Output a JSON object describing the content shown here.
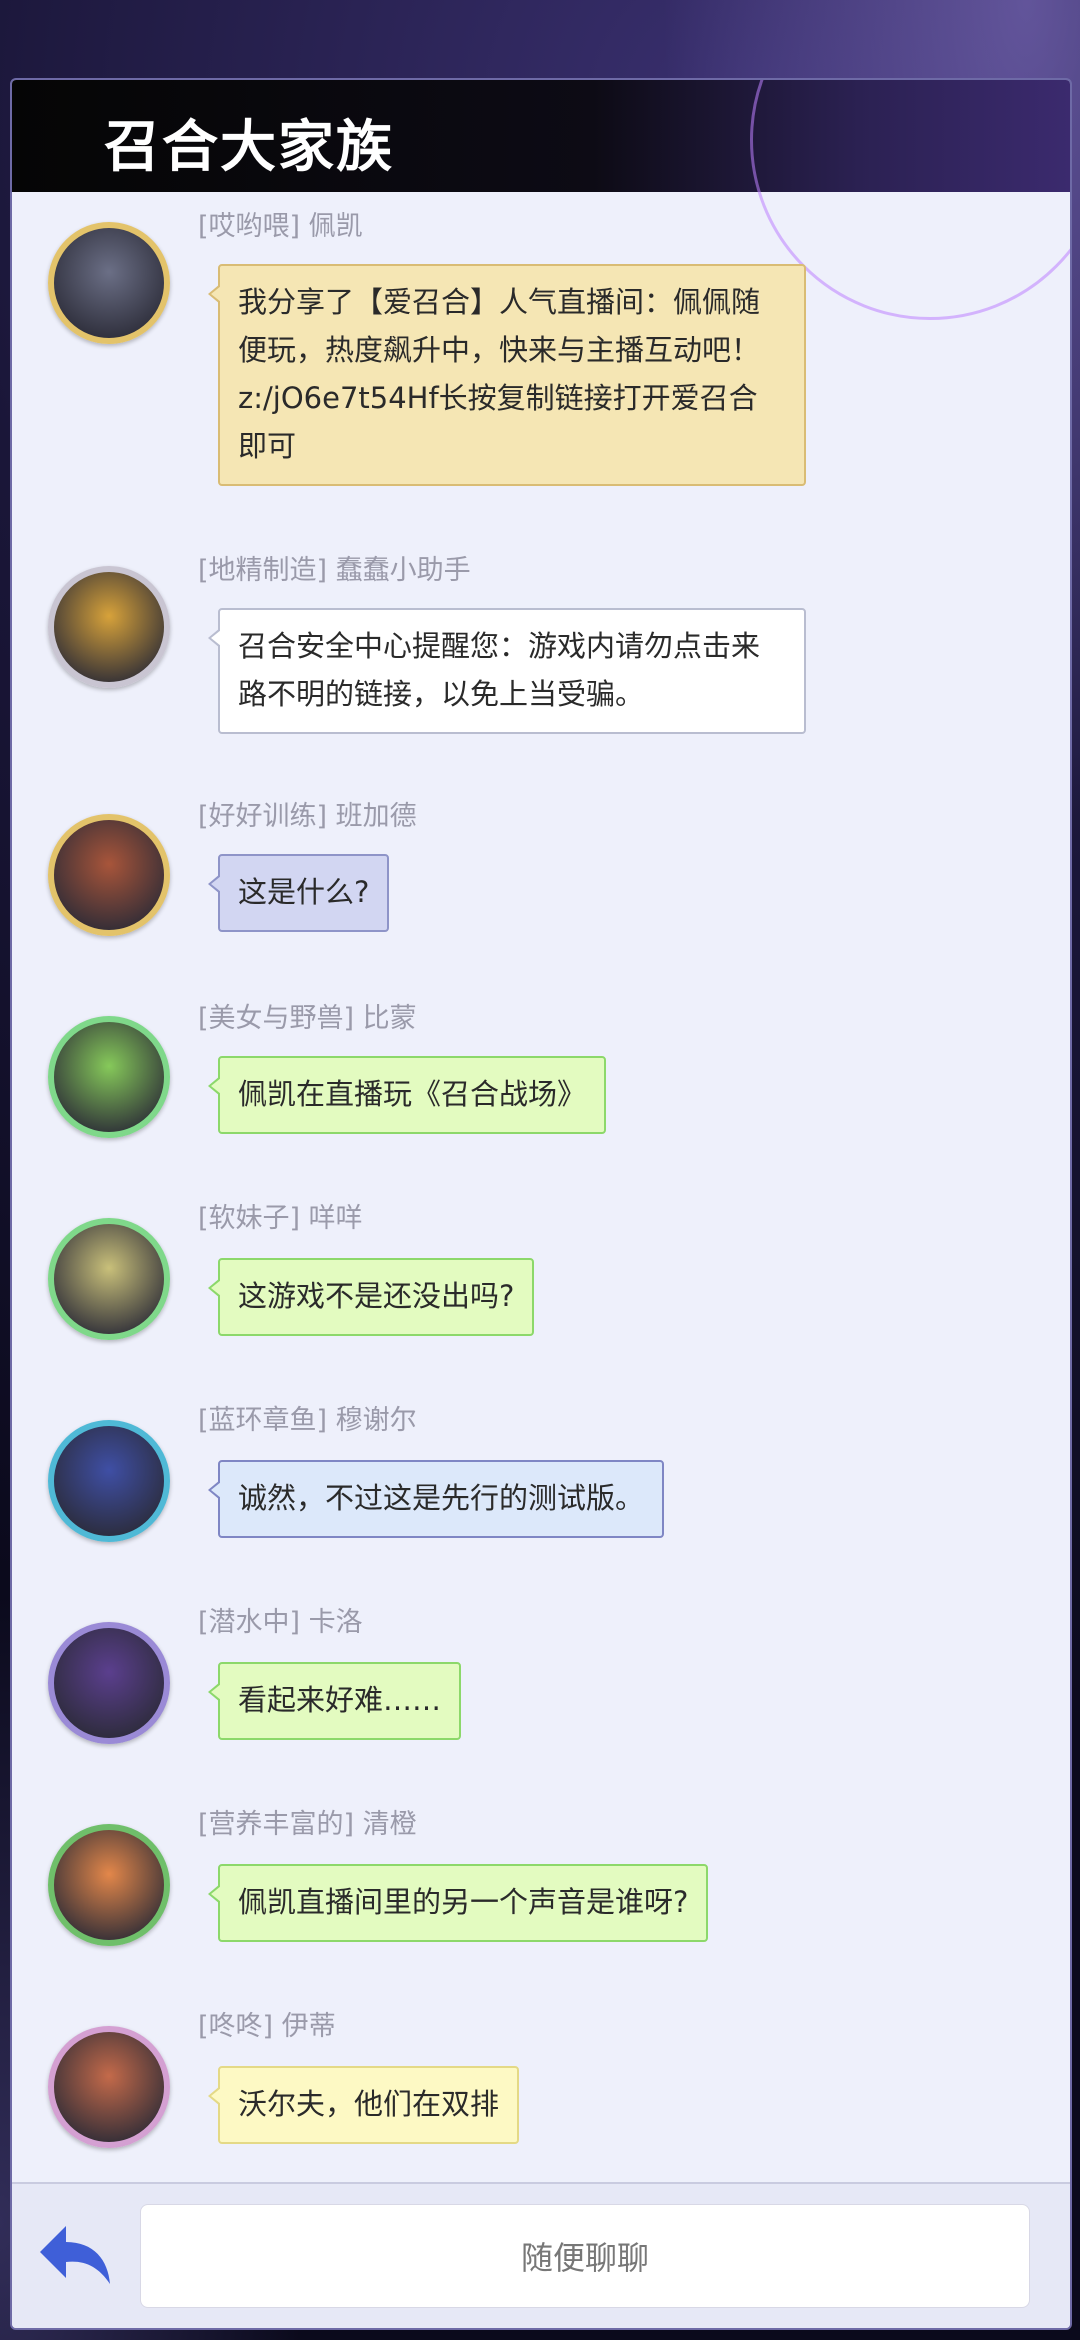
{
  "header": {
    "title": "召合大家族"
  },
  "messages": [
    {
      "tag": "[哎哟喂]",
      "name": "佩凯",
      "text": "我分享了【爱召合】人气直播间：佩佩随便玩，热度飙升中，快来与主播互动吧！z:/jO6e7t54Hf长按复制链接打开爱召合即可",
      "bubble_bg": "#f5e6b4",
      "bubble_border": "#d9bc74",
      "ring": "#e3c36a",
      "avatar_color": "#6b6f86"
    },
    {
      "tag": "[地精制造]",
      "name": "蠢蠢小助手",
      "text": "召合安全中心提醒您：游戏内请勿点击来路不明的链接，以免上当受骗。",
      "bubble_bg": "#ffffff",
      "bubble_border": "#b9bdd0",
      "ring": "#c9c5d2",
      "avatar_color": "#d7a23a"
    },
    {
      "tag": "[好好训练]",
      "name": "班加德",
      "text": "这是什么?",
      "bubble_bg": "#d2d6f2",
      "bubble_border": "#8e94c8",
      "ring": "#e3c36a",
      "avatar_color": "#a8553a"
    },
    {
      "tag": "[美女与野兽]",
      "name": "比蒙",
      "text": "佩凯在直播玩《召合战场》",
      "bubble_bg": "#e3fbc0",
      "bubble_border": "#8cd86a",
      "ring": "#7fd88a",
      "avatar_color": "#86c95a"
    },
    {
      "tag": "[软妹子]",
      "name": "咩咩",
      "text": "这游戏不是还没出吗?",
      "bubble_bg": "#e3fbc0",
      "bubble_border": "#8cd86a",
      "ring": "#7fd88a",
      "avatar_color": "#c9c07a"
    },
    {
      "tag": "[蓝环章鱼]",
      "name": "穆谢尔",
      "text": "诚然，不过这是先行的测试版。",
      "bubble_bg": "#dce8fa",
      "bubble_border": "#7f86c4",
      "ring": "#4fb9d6",
      "avatar_color": "#3f4fa5"
    },
    {
      "tag": "[潜水中]",
      "name": "卡洛",
      "text": "看起来好难……",
      "bubble_bg": "#e3fbc0",
      "bubble_border": "#8cd86a",
      "ring": "#9a8ad6",
      "avatar_color": "#5b3f8e"
    },
    {
      "tag": "[营养丰富的]",
      "name": "清橙",
      "text": "佩凯直播间里的另一个声音是谁呀?",
      "bubble_bg": "#e3fbc0",
      "bubble_border": "#8cd86a",
      "ring": "#6fbf6a",
      "avatar_color": "#e3874a"
    },
    {
      "tag": "[咚咚]",
      "name": "伊蒂",
      "text": "沃尔夫，他们在双排",
      "bubble_bg": "#fdf9c4",
      "bubble_border": "#e4d986",
      "ring": "#d4a0d2",
      "avatar_color": "#c46a4a"
    }
  ],
  "footer": {
    "input_placeholder": "随便聊聊",
    "back_icon": "back-arrow-icon",
    "back_color": "#3f5fd8"
  }
}
